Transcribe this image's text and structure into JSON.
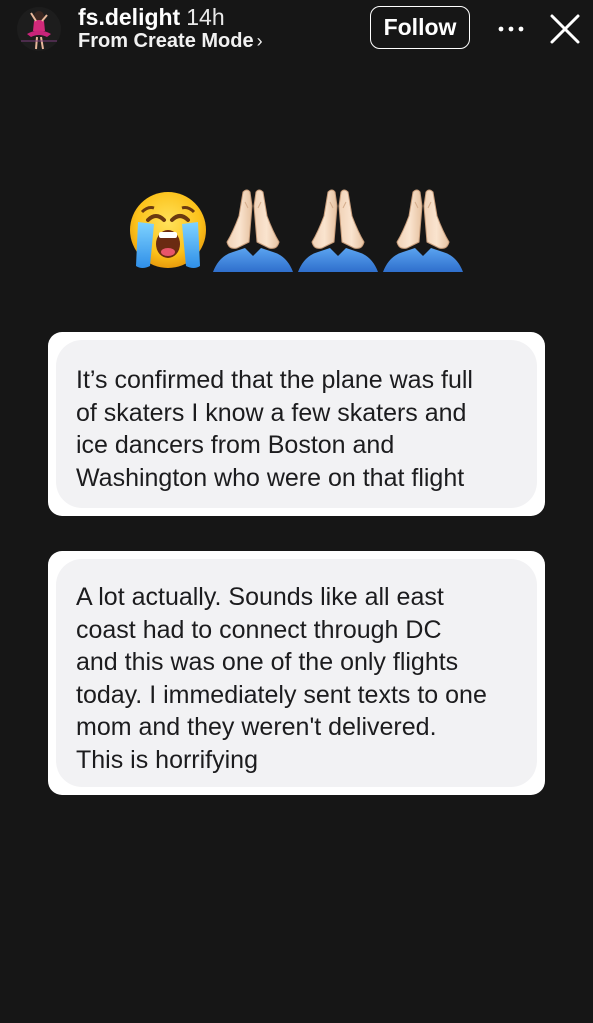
{
  "header": {
    "username": "fs.delight",
    "timestamp": "14h",
    "subtitle": "From Create Mode",
    "follow_label": "Follow"
  },
  "icons": {
    "avatar": "profile-photo-skater",
    "more": "more-horizontal-icon",
    "close": "close-icon",
    "reaction": [
      "loudly-crying-face",
      "folded-hands",
      "folded-hands",
      "folded-hands"
    ]
  },
  "messages": [
    {
      "lines": [
        "It’s confirmed that the plane was full",
        "of skaters I know a few skaters and",
        "ice dancers from Boston and",
        "Washington who were on that flight"
      ]
    },
    {
      "lines": [
        "A lot actually. Sounds like all east",
        "coast had to connect through DC",
        "and this was one of the only flights",
        "today. I immediately sent texts to one",
        "mom and they weren't delivered.",
        "This is horrifying"
      ]
    }
  ],
  "colors": {
    "background": "#161616",
    "card": "#ffffff",
    "bubble": "#f2f2f4",
    "text_dark": "#1c1c1e"
  }
}
